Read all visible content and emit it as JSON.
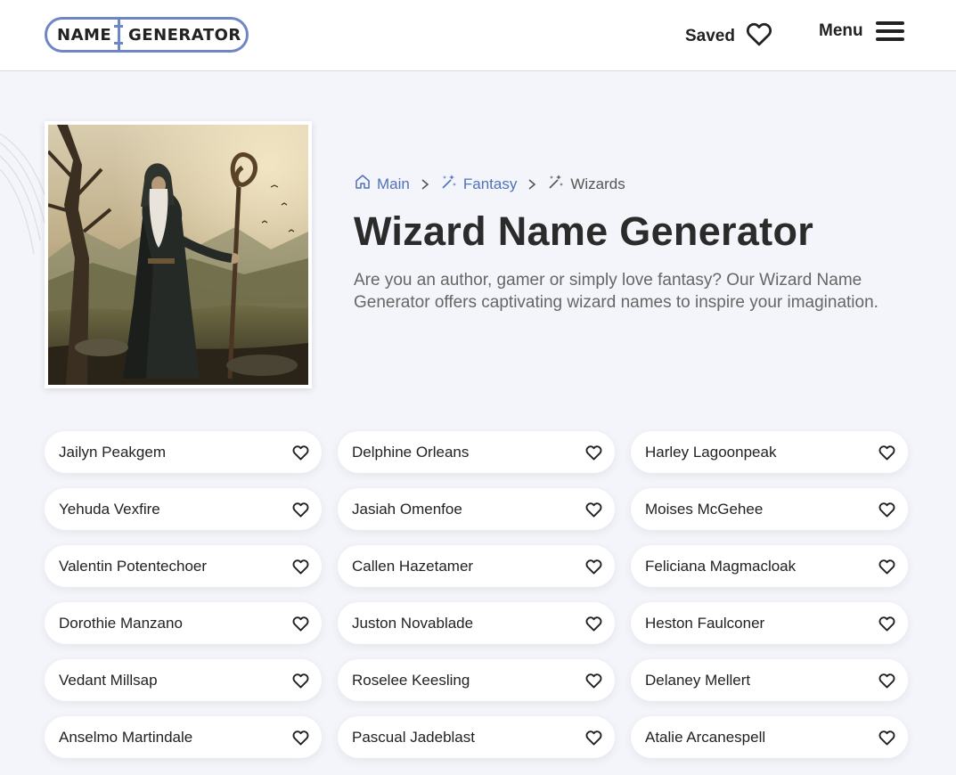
{
  "header": {
    "logo_left": "NAME",
    "logo_right": "GENERATOR",
    "saved_label": "Saved",
    "menu_label": "Menu"
  },
  "breadcrumb": {
    "items": [
      {
        "label": "Main",
        "icon": "home-icon"
      },
      {
        "label": "Fantasy",
        "icon": "magic-wand-icon"
      },
      {
        "label": "Wizards",
        "icon": "magic-wand-icon"
      }
    ]
  },
  "hero": {
    "title": "Wizard Name Generator",
    "intro": "Are you an author, gamer or simply love fantasy? Our Wizard Name Generator offers captivating wizard names to inspire your imagination."
  },
  "names": [
    "Jailyn Peakgem",
    "Delphine Orleans",
    "Harley Lagoonpeak",
    "Yehuda Vexfire",
    "Jasiah Omenfoe",
    "Moises McGehee",
    "Valentin Potentechoer",
    "Callen Hazetamer",
    "Feliciana Magmacloak",
    "Dorothie Manzano",
    "Juston Novablade",
    "Heston Faulconer",
    "Vedant Millsap",
    "Roselee Keesling",
    "Delaney Mellert",
    "Anselmo Martindale",
    "Pascual Jadeblast",
    "Atalie Arcanespell"
  ],
  "colors": {
    "accent": "#4f72b8",
    "logo_border": "#6f86c4",
    "background": "#f4f5fa"
  }
}
